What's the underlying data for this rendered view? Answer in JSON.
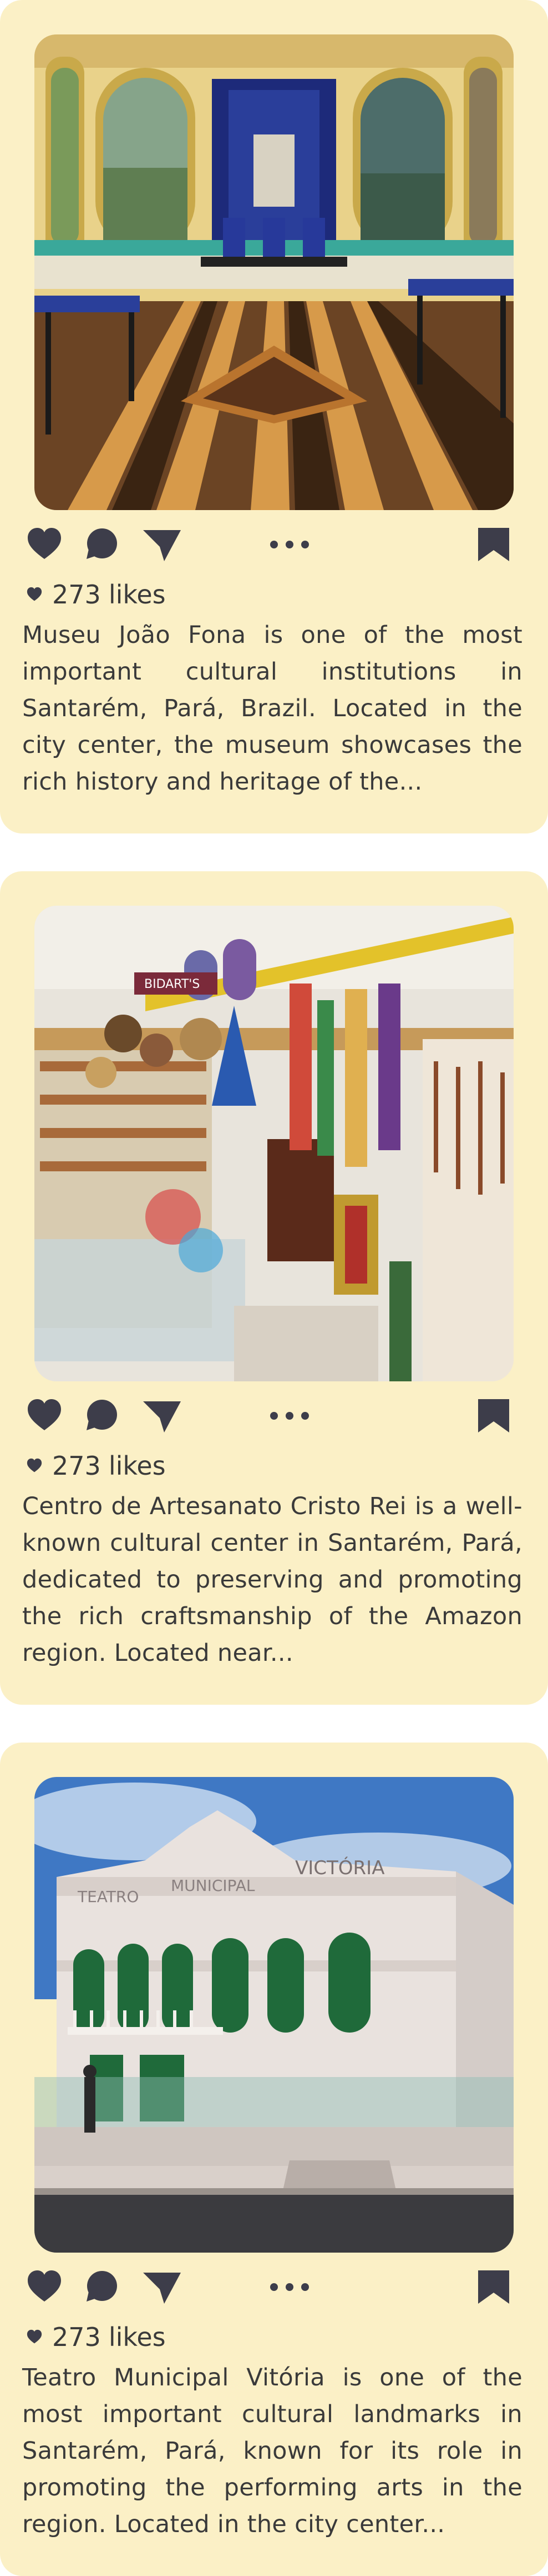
{
  "posts": [
    {
      "likes_count": "273",
      "likes_label": "likes",
      "caption": "Museu João Fona is one of the most important cultural institutions in Santarém, Pará, Brazil. Located in the city center, the museum showcases the rich history and heritage of the..."
    },
    {
      "likes_count": "273",
      "likes_label": "likes",
      "caption": "Centro de Artesanato Cristo Rei is a well-known cultural center in Santarém, Pará, dedicated to preserving and promoting the rich craftsmanship of the Amazon region. Located near..."
    },
    {
      "likes_count": "273",
      "likes_label": "likes",
      "caption": "Teatro Municipal Vitória is one of the most important cultural landmarks in Santarém, Pará, known for its role in promoting the performing arts in the region. Located in the city center..."
    }
  ],
  "photo_signs": {
    "shop_sign": "BIDART'S",
    "theatre_sign_left": "TEATRO",
    "theatre_sign_mid": "MUNICIPAL",
    "theatre_sign_right": "VICTÓRIA"
  },
  "icons": [
    "heart-icon",
    "comment-icon",
    "send-icon",
    "more-icon",
    "bookmark-icon"
  ],
  "colors": {
    "card_bg": "#fbf0c6",
    "icon": "#3d3d4a",
    "text": "#3a3a3a"
  }
}
